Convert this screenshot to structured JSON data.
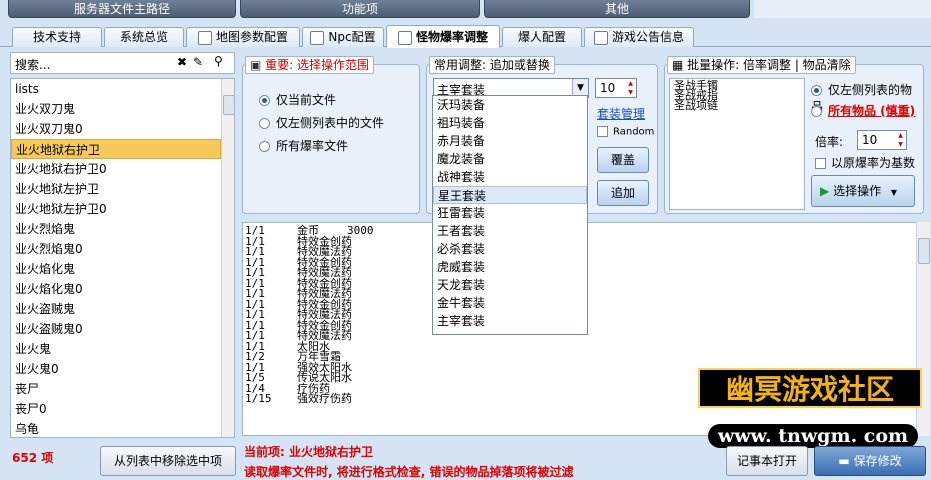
{
  "top": {
    "b1": "服务器文件主路径",
    "b2": "功能项",
    "b3": "其他"
  },
  "tabs": [
    "技术支持",
    "系统总览",
    "地图参数配置",
    "Npc配置",
    "怪物爆率调整",
    "爆人配置",
    "游戏公告信息"
  ],
  "search": {
    "placeholder": "搜索..."
  },
  "list": {
    "items": [
      "lists",
      "业火双刀鬼",
      "业火双刀鬼0",
      "业火地狱右护卫",
      "业火地狱右护卫0",
      "业火地狱左护卫",
      "业火地狱左护卫0",
      "业火烈焰鬼",
      "业火烈焰鬼0",
      "业火焰化鬼",
      "业火焰化鬼0",
      "业火盗贼鬼",
      "业火盗贼鬼0",
      "业火鬼",
      "业火鬼0",
      "丧尸",
      "丧尸0",
      "乌龟"
    ],
    "selected": 3
  },
  "scope": {
    "title": "重要: 选择操作范围",
    "opt1": "仅当前文件",
    "opt2": "仅左侧列表中的文件",
    "opt3": "所有爆率文件"
  },
  "common": {
    "title": "常用调整: 追加或替换",
    "select_value": "主宰套装",
    "number": "10",
    "link": "套装管理",
    "random": "Random",
    "btn1": "覆盖",
    "btn2": "追加",
    "options": [
      "沃玛装备",
      "祖玛装备",
      "赤月装备",
      "魔龙装备",
      "战神套装",
      "星王套装",
      "狂雷套装",
      "王者套装",
      "必杀套装",
      "虎威套装",
      "天龙套装",
      "金牛套装",
      "主宰套装"
    ],
    "highlight": 5
  },
  "batch": {
    "title": "批量操作: 倍率调整 | 物品清除",
    "items": [
      "圣战手镯",
      "圣战戒指",
      "圣战项链"
    ],
    "opt1": "仅左侧列表的物品",
    "opt2": "所有物品 (慎重)",
    "rate_label": "倍率:",
    "rate": "10",
    "base": "以原爆率为基数",
    "action": "选择操作"
  },
  "log": [
    [
      "1/1",
      "金币",
      "3000"
    ],
    [
      "1/1",
      "特效金创药",
      ""
    ],
    [
      "1/1",
      "特效魔法药",
      ""
    ],
    [
      "1/1",
      "特效金创药",
      ""
    ],
    [
      "1/1",
      "特效魔法药",
      ""
    ],
    [
      "1/1",
      "特效金创药",
      ""
    ],
    [
      "1/1",
      "特效魔法药",
      ""
    ],
    [
      "1/1",
      "特效金创药",
      ""
    ],
    [
      "1/1",
      "特效魔法药",
      ""
    ],
    [
      "1/1",
      "特效金创药",
      ""
    ],
    [
      "1/1",
      "特效魔法药",
      ""
    ],
    [
      "1/1",
      "太阳水",
      ""
    ],
    [
      "1/2",
      "万年雪霜",
      ""
    ],
    [
      "1/1",
      "强效太阳水",
      ""
    ],
    [
      "1/5",
      "传说太阳水",
      ""
    ],
    [
      "1/4",
      "疗伤药",
      ""
    ],
    [
      "1/15",
      "强效疗伤药",
      ""
    ]
  ],
  "footer": {
    "count": "652 项",
    "remove": "从列表中移除选中项",
    "current_label": "当前项:",
    "current": "业火地狱右护卫",
    "notice": "读取爆率文件时, 将进行格式检查, 错误的物品掉落项将被过滤",
    "notepad": "记事本打开",
    "save": "保存修改"
  },
  "watermark": {
    "text1": "幽冥游戏社区",
    "text2": "www. tnwgm. com"
  }
}
